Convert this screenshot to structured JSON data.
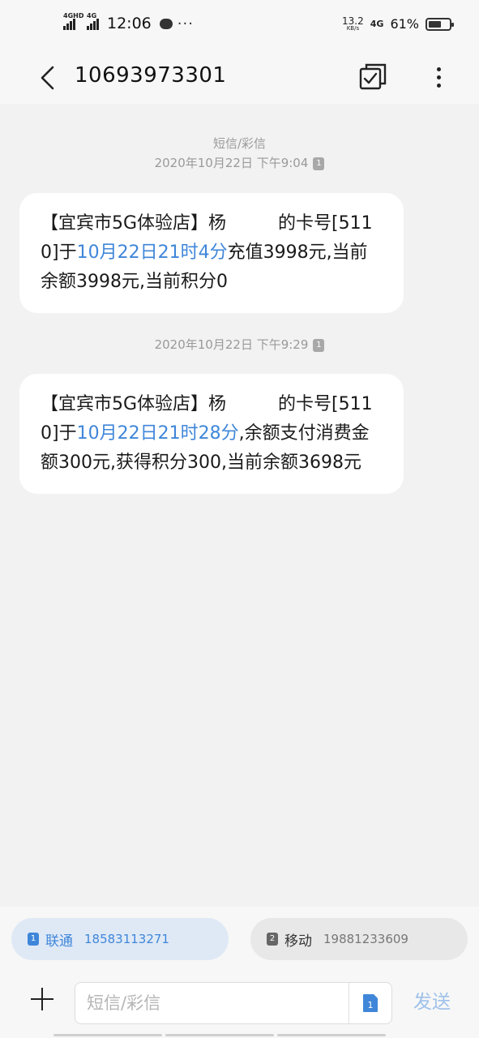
{
  "status_bar": {
    "sim1_tag": "4GHD",
    "sim2_tag": "4G",
    "time": "12:06",
    "dots": "···",
    "net_speed": "13.2",
    "net_unit": "KB/s",
    "net_type": "4G",
    "battery_pct": "61%",
    "battery_level": 0.61
  },
  "header": {
    "title": "10693973301"
  },
  "conversation": {
    "type_label": "短信/彩信",
    "messages": [
      {
        "timestamp": "2020年10月22日 下午9:04",
        "sim_tag": "1",
        "parts": [
          "【宜宾市5G体验店】杨",
          "的卡号[5110]于",
          "10月22日21时4分",
          "充值3998元,当前余额3998元,当前积分0"
        ]
      },
      {
        "timestamp": "2020年10月22日 下午9:29",
        "sim_tag": "1",
        "parts": [
          "【宜宾市5G体验店】杨",
          "的卡号[5110]于",
          "10月22日21时28分",
          ",余额支付消费金额300元,获得积分300,当前余额3698元"
        ]
      }
    ]
  },
  "sim_selector": {
    "sim1": {
      "index": "1",
      "name": "联通",
      "number": "18583113271"
    },
    "sim2": {
      "index": "2",
      "name": "移动",
      "number": "19881233609"
    }
  },
  "composer": {
    "placeholder": "短信/彩信",
    "sim_badge": "1",
    "send_label": "发送"
  },
  "colors": {
    "link": "#3f86d9",
    "send_disabled": "#9fc1ea",
    "background": "#f2f2f2"
  }
}
